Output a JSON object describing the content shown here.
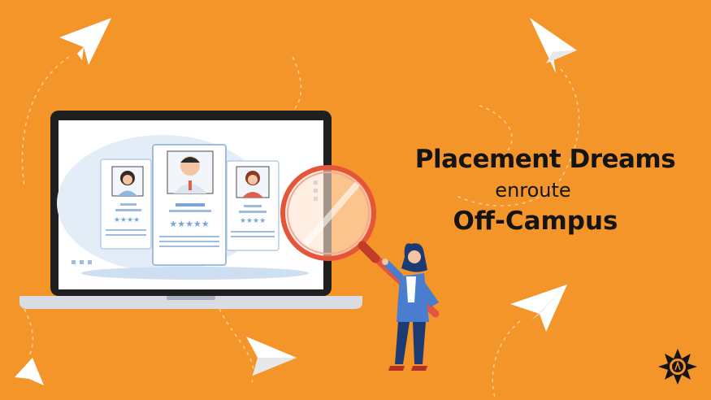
{
  "headline": {
    "line1": "Placement Dreams",
    "line2": "enroute",
    "line3": "Off-Campus"
  },
  "colors": {
    "background": "#f4952a",
    "text": "#141414",
    "screen": "#ffffff",
    "laptop_frame": "#1f1f1f",
    "accent_blue": "#7aa6d6",
    "magnifier_ring": "#e5553a"
  },
  "icons": [
    "paper-plane-icon",
    "person-card-icon",
    "magnifying-glass-icon",
    "logo-icon"
  ],
  "profile_cards": [
    {
      "rating": 4
    },
    {
      "rating": 5
    },
    {
      "rating": 4
    }
  ]
}
